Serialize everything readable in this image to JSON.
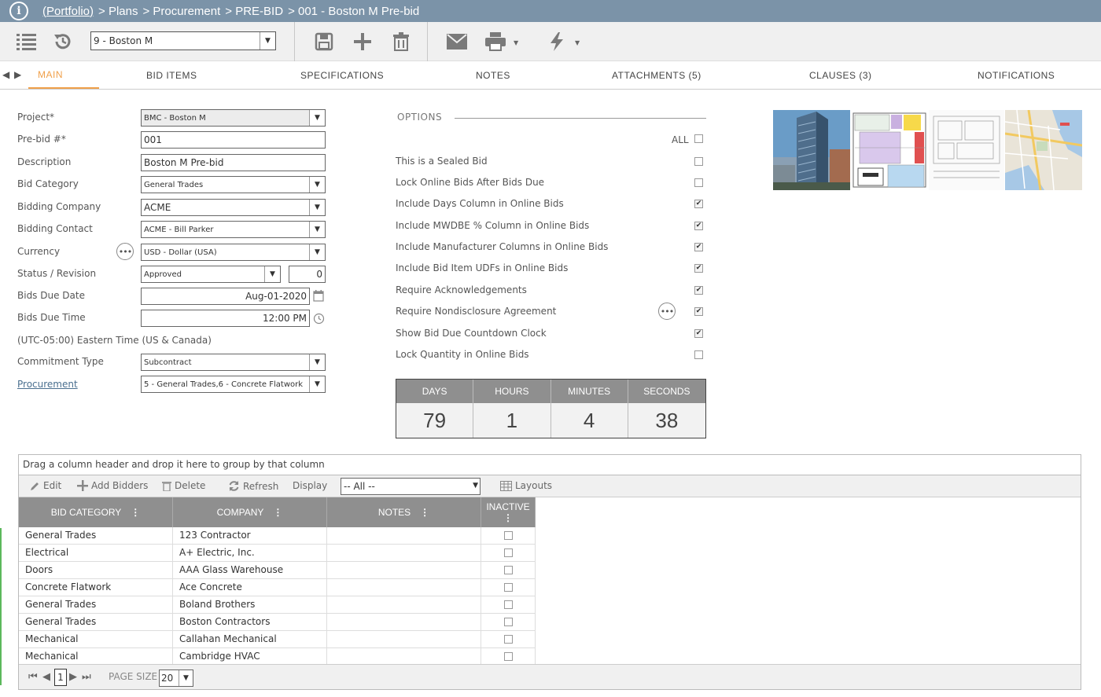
{
  "header": {
    "breadcrumb": [
      "(Portfolio)",
      "> Plans",
      "> Procurement",
      "> PRE-BID",
      "> 001 - Boston M Pre-bid"
    ]
  },
  "toolbar": {
    "record_select_value": "9 -  Boston M"
  },
  "tabs": [
    {
      "label": "MAIN",
      "active": true
    },
    {
      "label": "BID ITEMS"
    },
    {
      "label": "SPECIFICATIONS"
    },
    {
      "label": "NOTES"
    },
    {
      "label": "ATTACHMENTS (5)"
    },
    {
      "label": "CLAUSES (3)"
    },
    {
      "label": "NOTIFICATIONS"
    }
  ],
  "form": {
    "project": {
      "label": "Project*",
      "value": "BMC - Boston M"
    },
    "prebid_no": {
      "label": "Pre-bid #*",
      "value": "001"
    },
    "description": {
      "label": "Description",
      "value": "Boston M Pre-bid"
    },
    "bid_category": {
      "label": "Bid Category",
      "value": "General Trades"
    },
    "bidding_company": {
      "label": "Bidding Company",
      "value": "ACME"
    },
    "bidding_contact": {
      "label": "Bidding Contact",
      "value": "ACME - Bill Parker"
    },
    "currency": {
      "label": "Currency",
      "value": "USD - Dollar (USA)"
    },
    "status": {
      "label": "Status / Revision",
      "value": "Approved",
      "revision": "0"
    },
    "bids_due_date": {
      "label": "Bids Due Date",
      "value": "Aug-01-2020"
    },
    "bids_due_time": {
      "label": "Bids Due Time",
      "value": "12:00 PM"
    },
    "timezone": "(UTC-05:00) Eastern Time (US & Canada)",
    "commitment_type": {
      "label": "Commitment Type",
      "value": "Subcontract"
    },
    "procurement": {
      "label": "Procurement",
      "value": "5 - General Trades,6 - Concrete Flatwork"
    }
  },
  "options": {
    "title": "OPTIONS",
    "all_label": "ALL",
    "items": [
      {
        "label": "This is a Sealed Bid",
        "checked": false
      },
      {
        "label": "Lock Online Bids After Bids Due",
        "checked": false
      },
      {
        "label": "Include Days Column in Online Bids",
        "checked": true
      },
      {
        "label": "Include MWDBE % Column in Online Bids",
        "checked": true
      },
      {
        "label": "Include Manufacturer Columns in Online Bids",
        "checked": true
      },
      {
        "label": "Include Bid Item UDFs in Online Bids",
        "checked": true
      },
      {
        "label": "Require Acknowledgements",
        "checked": true
      },
      {
        "label": "Require Nondisclosure Agreement",
        "checked": true
      },
      {
        "label": "Show Bid Due Countdown Clock",
        "checked": true
      },
      {
        "label": "Lock Quantity in Online Bids",
        "checked": false
      }
    ]
  },
  "countdown": {
    "days_label": "DAYS",
    "days": "79",
    "hours_label": "HOURS",
    "hours": "1",
    "minutes_label": "MINUTES",
    "minutes": "4",
    "seconds_label": "SECONDS",
    "seconds": "38"
  },
  "grid": {
    "group_hint": "Drag a column header and drop it here to group by that column",
    "toolbar": {
      "edit": "Edit",
      "add_bidders": "Add Bidders",
      "delete": "Delete",
      "refresh": "Refresh",
      "display": "Display",
      "display_value": "-- All --",
      "layouts": "Layouts"
    },
    "columns": [
      "BID CATEGORY",
      "COMPANY",
      "NOTES",
      "INACTIVE"
    ],
    "rows": [
      {
        "category": "General Trades",
        "company": "123 Contractor"
      },
      {
        "category": "Electrical",
        "company": "A+ Electric, Inc."
      },
      {
        "category": "Doors",
        "company": "AAA Glass Warehouse"
      },
      {
        "category": "Concrete Flatwork",
        "company": "Ace Concrete"
      },
      {
        "category": "General Trades",
        "company": "Boland Brothers"
      },
      {
        "category": "General Trades",
        "company": "Boston Contractors"
      },
      {
        "category": "Mechanical",
        "company": "Callahan Mechanical"
      },
      {
        "category": "Mechanical",
        "company": "Cambridge HVAC"
      }
    ],
    "pager": {
      "page": "1",
      "page_size_label": "PAGE SIZE",
      "page_size": "20"
    }
  }
}
